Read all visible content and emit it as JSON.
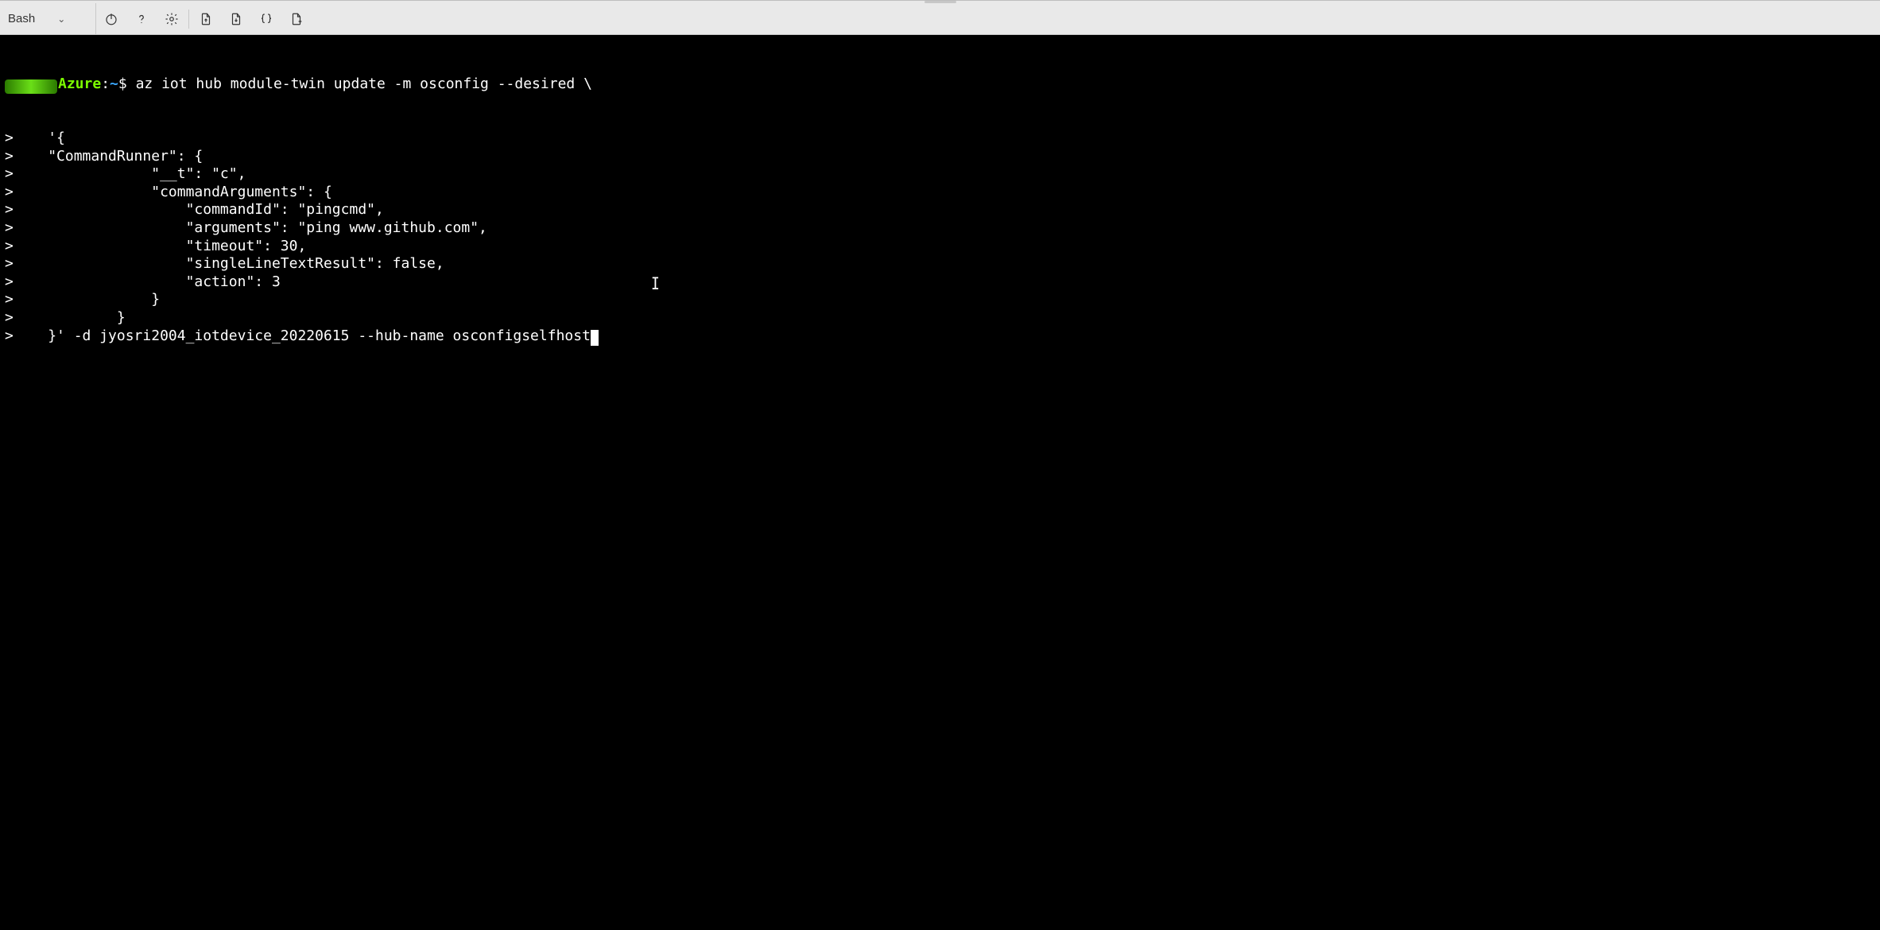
{
  "toolbar": {
    "shell_name": "Bash",
    "icons": [
      {
        "name": "power-icon",
        "interact": true
      },
      {
        "name": "help-icon",
        "interact": true
      },
      {
        "name": "settings-icon",
        "interact": true
      },
      {
        "name": "download-file-icon",
        "interact": true
      },
      {
        "name": "upload-file-icon",
        "interact": true
      },
      {
        "name": "braces-icon",
        "interact": true
      },
      {
        "name": "new-session-icon",
        "interact": true
      }
    ],
    "chevron_glyph": "⌄"
  },
  "terminal": {
    "prompt_label_green": "Azure",
    "prompt_path": "~",
    "prompt_symbol": "$",
    "colon": ":",
    "first_cmd": "az iot hub module-twin update -m osconfig --desired \\",
    "cont": ">",
    "lines": [
      "    '{",
      "    \"CommandRunner\": {",
      "                \"__t\": \"c\",",
      "                \"commandArguments\": {",
      "                    \"commandId\": \"pingcmd\",",
      "                    \"arguments\": \"ping www.github.com\",",
      "                    \"timeout\": 30,",
      "                    \"singleLineTextResult\": false,",
      "                    \"action\": 3",
      "                }",
      "            }",
      "    }' -d jyosri2004_iotdevice_20220615 --hub-name osconfigselfhost"
    ],
    "text_cursor_glyph": "I"
  }
}
